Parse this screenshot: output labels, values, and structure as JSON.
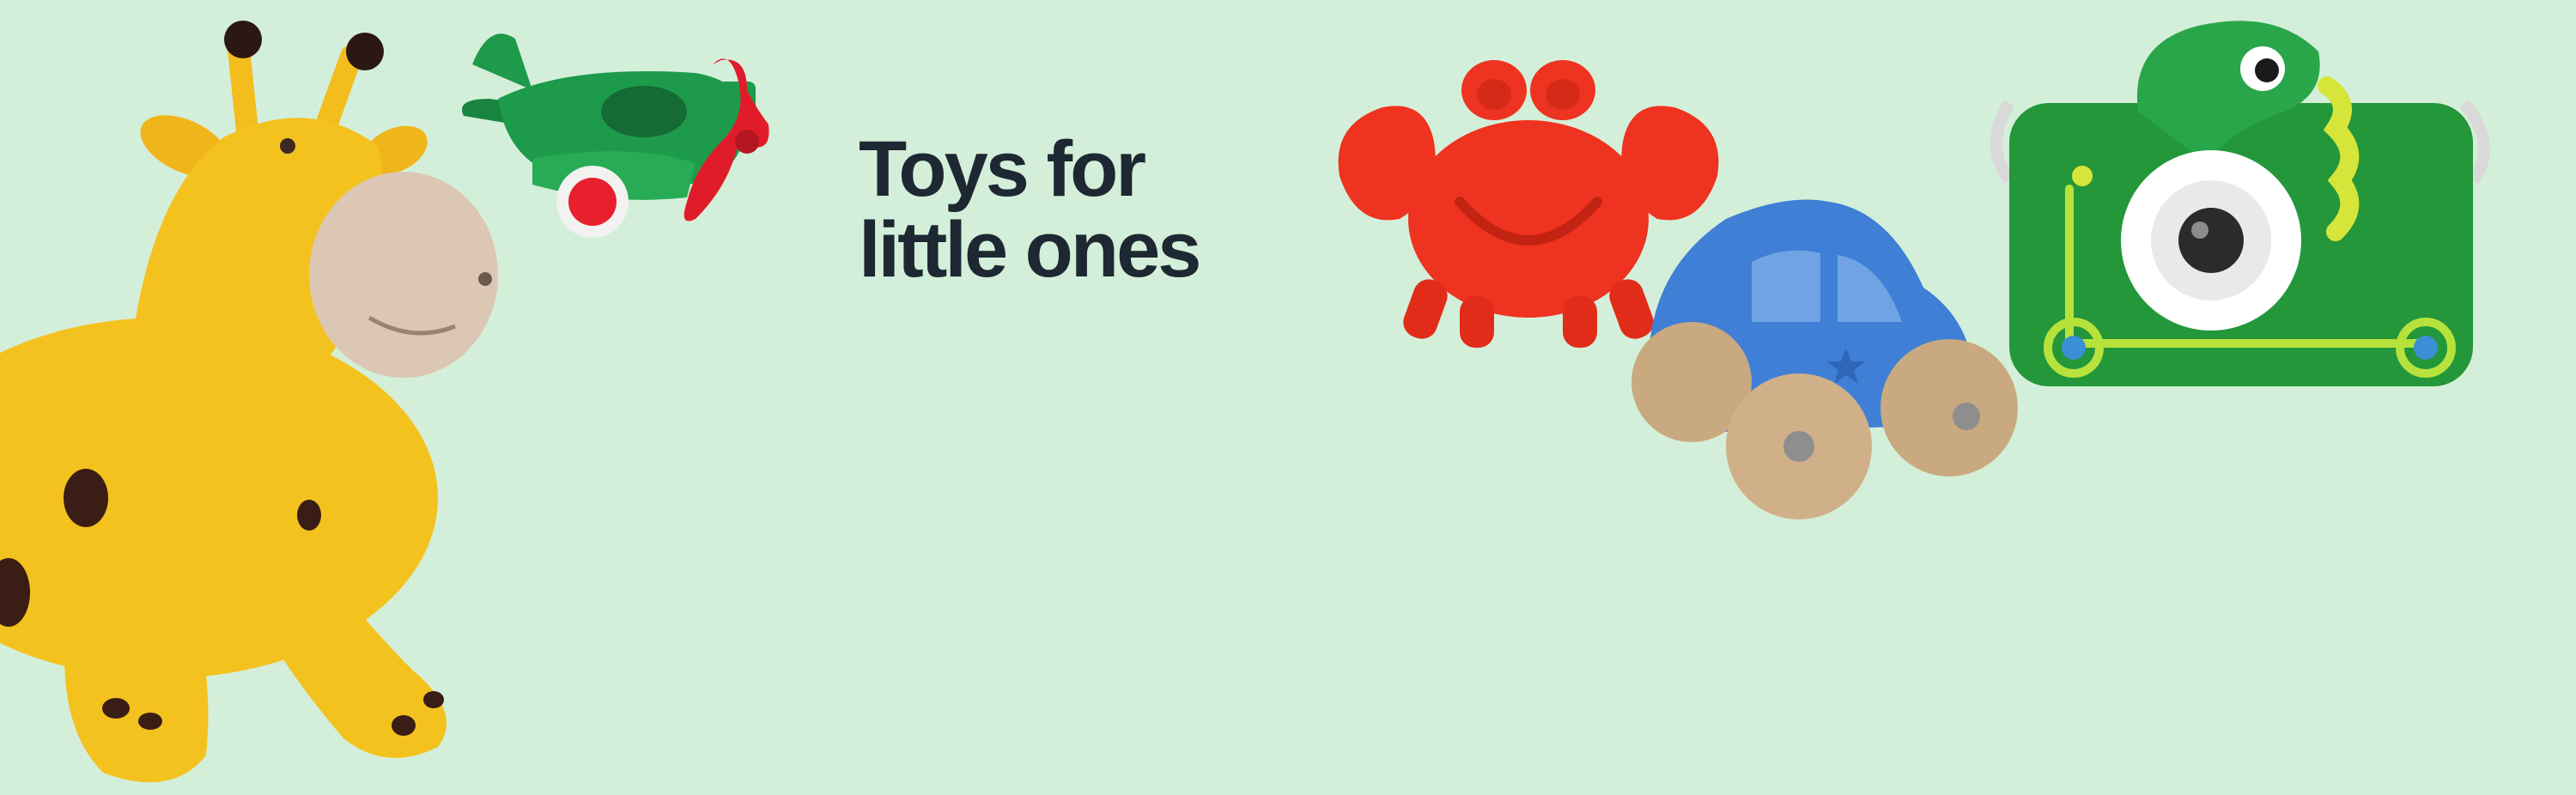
{
  "banner": {
    "headline_line1": "Toys for",
    "headline_line2": "little ones",
    "background_color": "#d4efd9",
    "text_color": "#1d2833"
  },
  "toys": [
    {
      "name": "giraffe-hopper-toy",
      "color": "#f2bd1d"
    },
    {
      "name": "airplane-toy",
      "color": "#1e9a4b"
    },
    {
      "name": "crab-sand-mold-toy",
      "color": "#ee3320"
    },
    {
      "name": "wooden-car-toy",
      "color": "#3f7fd6"
    },
    {
      "name": "dinosaur-kids-camera",
      "color": "#23973a"
    }
  ]
}
